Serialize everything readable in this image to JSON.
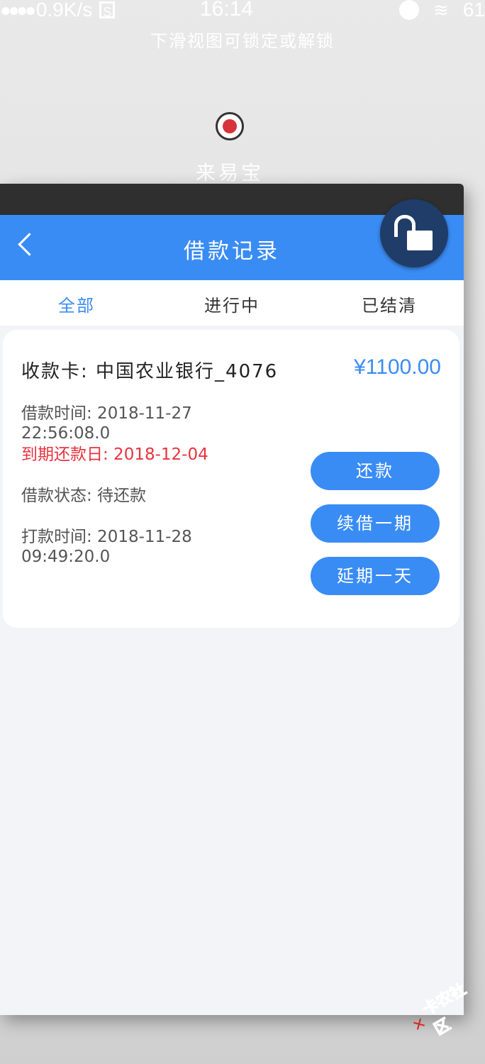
{
  "status_bar": {
    "signal": "●●●●",
    "speed": "0.9K/s",
    "s_icon": "S",
    "time": "16:14",
    "battery_partial": "61"
  },
  "hint": "下滑视图可锁定或解锁",
  "app": {
    "name": "来易宝",
    "logo_icon": "app-logo-icon"
  },
  "nav": {
    "title": "借款记录"
  },
  "tabs": [
    {
      "label": "全部",
      "active": true
    },
    {
      "label": "进行中",
      "active": false
    },
    {
      "label": "已结清",
      "active": false
    }
  ],
  "card": {
    "card_label": "收款卡: 中国农业银行_4076",
    "amount": "¥1100.00",
    "loan_time_line1": "借款时间: 2018-11-27",
    "loan_time_line2": "22:56:08.0",
    "due_date": "到期还款日: 2018-12-04",
    "status": "借款状态: 待还款",
    "transfer_time_line1": "打款时间: 2018-11-28",
    "transfer_time_line2": "09:49:20.0",
    "buttons": {
      "repay": "还款",
      "renew": "续借一期",
      "extend": "延期一天"
    }
  },
  "watermark": "卡农社区",
  "colors": {
    "accent": "#3a8cf5",
    "danger": "#e8333d",
    "lock_bg": "#1f3d68"
  }
}
